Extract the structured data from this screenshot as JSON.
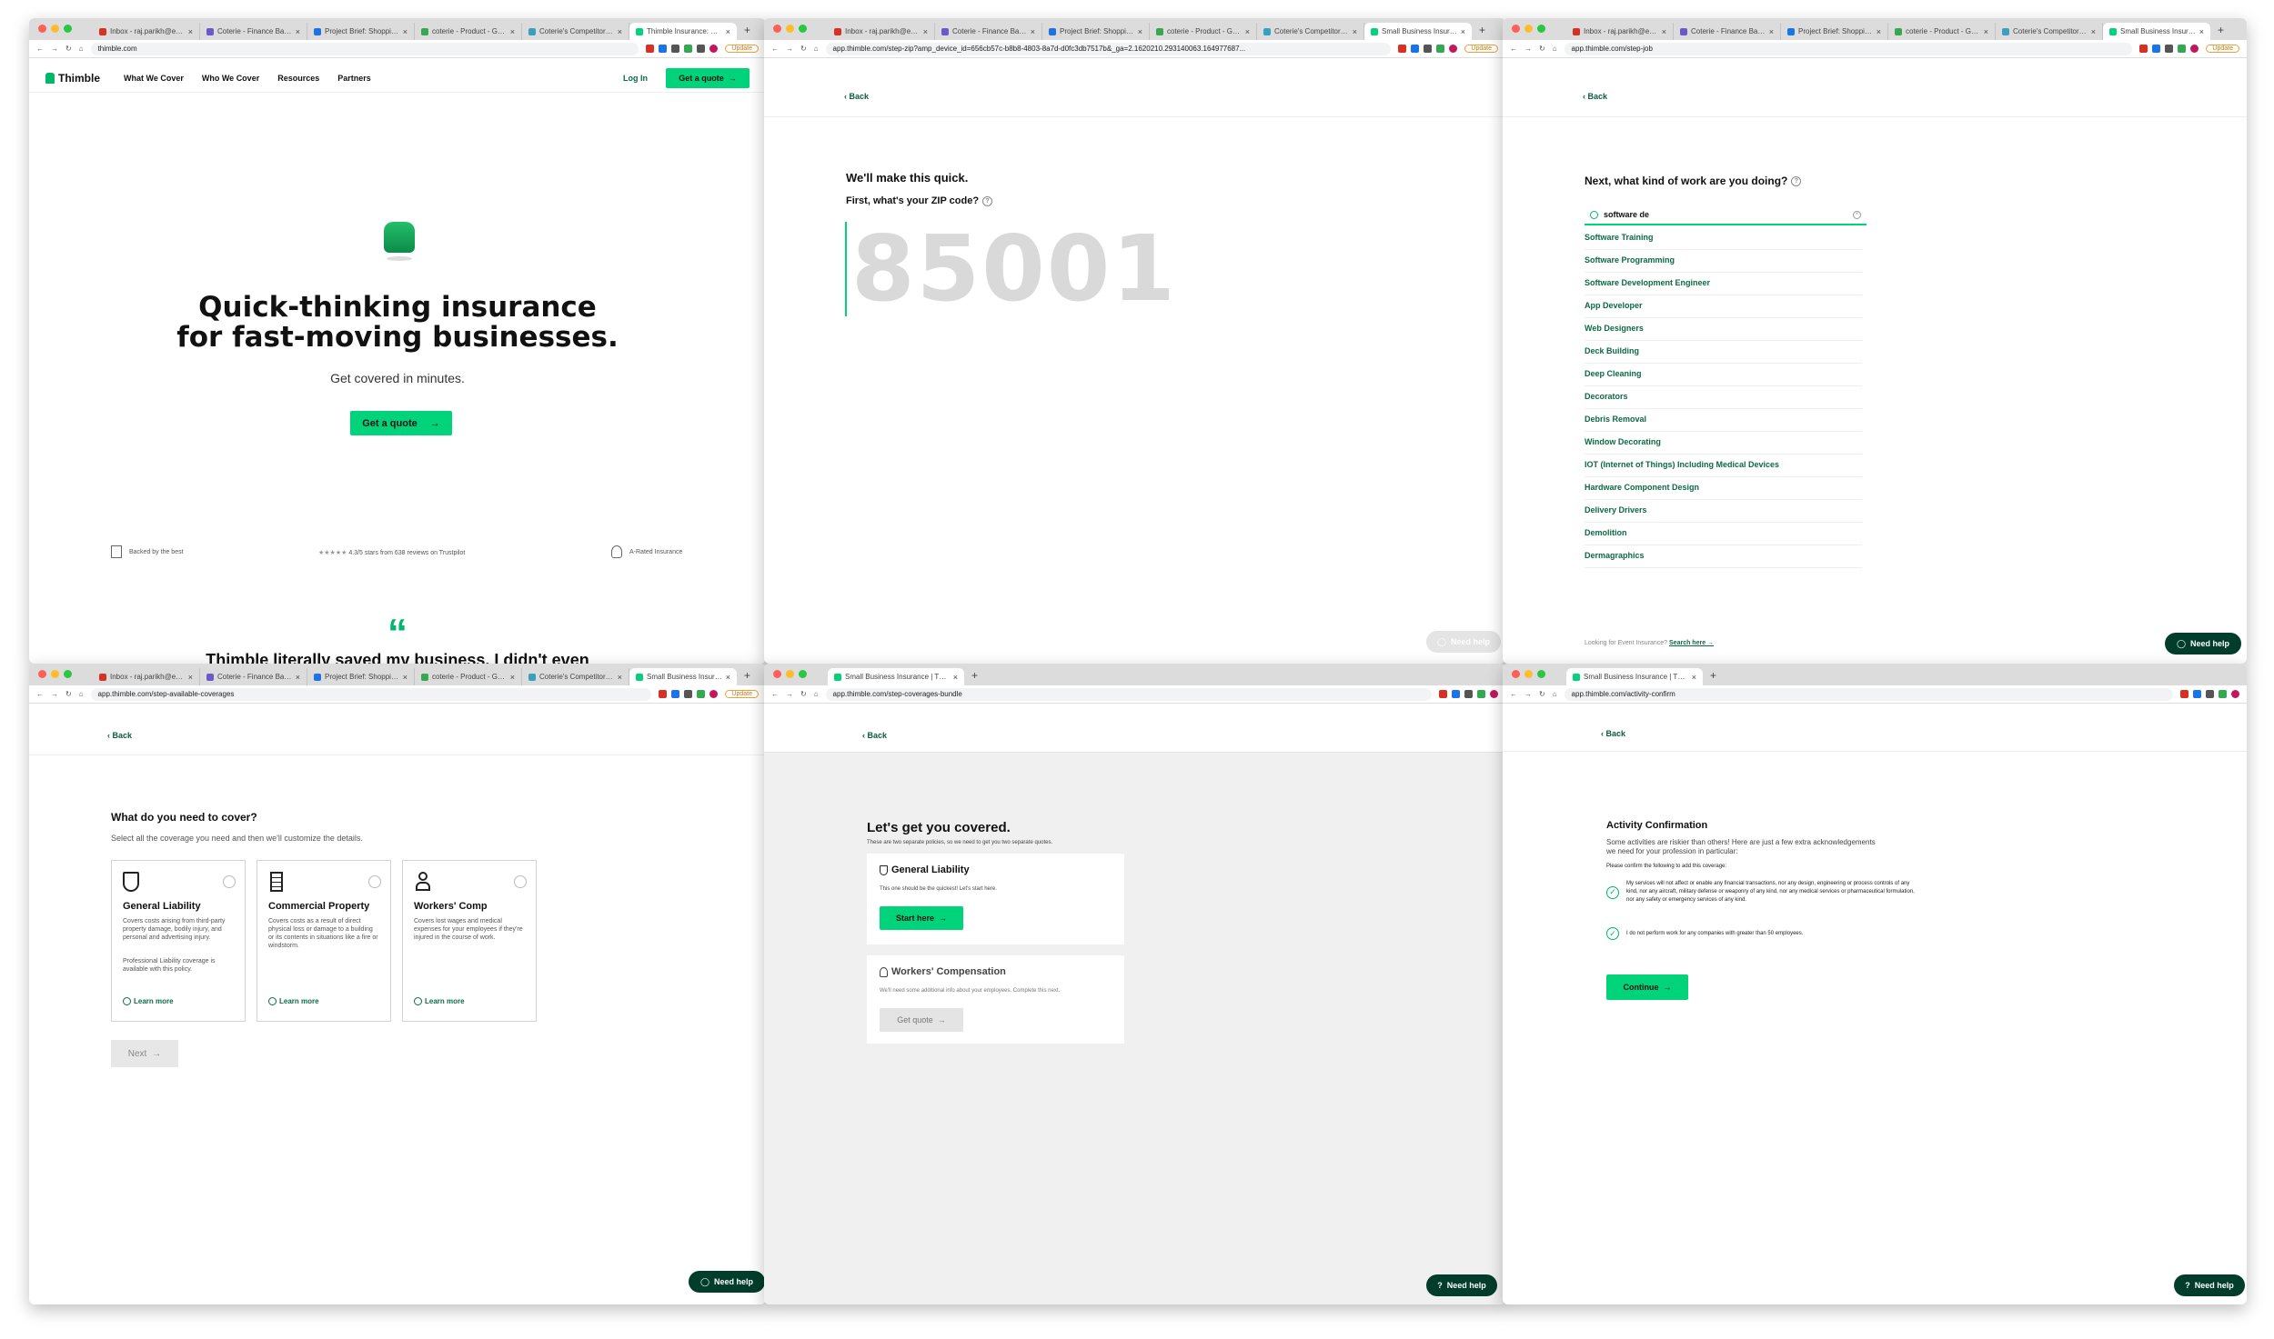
{
  "browser": {
    "tabs_main": [
      "Inbox - raj.parikh@embr...",
      "Coterie - Finance Basics",
      "Project Brief: Shopping e...",
      "coterie - Product - Goog...",
      "Coterie's Competitors, R...",
      "Small Business Insurance..."
    ],
    "tabs_short": [
      "Small Business Insurance | Thi..."
    ],
    "update_label": "Update"
  },
  "win1": {
    "tab_active": "Thimble Insurance: Onli...",
    "url": "thimble.com",
    "logo": "Thimble",
    "nav": [
      "What We Cover",
      "Who We Cover",
      "Resources",
      "Partners"
    ],
    "login": "Log In",
    "quote_button": "Get a quote",
    "headline1": "Quick-thinking insurance",
    "headline2": "for fast-moving businesses.",
    "subhead": "Get covered in minutes.",
    "cta": "Get a quote",
    "trust1": "Backed by the best",
    "trust2": "4.3/5 stars from 638 reviews on Trustpilot",
    "trust3": "A-Rated Insurance",
    "quote_mark": "“",
    "testimonial": "Thimble literally saved my business. I didn't even"
  },
  "win2": {
    "url": "app.thimble.com/step-zip?amp_device_id=656cb57c-b8b8-4803-8a7d-d0fc3db7517b&_ga=2.1620210.293140063.164977687...",
    "back": "Back",
    "title": "We'll make this quick.",
    "question": "First, what's your ZIP code?",
    "zip": "85001",
    "help": "Need help"
  },
  "win3": {
    "url": "app.thimble.com/step-job",
    "back": "Back",
    "question": "Next, what kind of work are you doing?",
    "search_value": "software de",
    "occupations": [
      "Software Training",
      "Software Programming",
      "Software Development Engineer",
      "App Developer",
      "Web Designers",
      "Deck Building",
      "Deep Cleaning",
      "Decorators",
      "Debris Removal",
      "Window Decorating",
      "IOT (Internet of Things) Including Medical Devices",
      "Hardware Component Design",
      "Delivery Drivers",
      "Demolition",
      "Dermagraphics"
    ],
    "footer_text": "Looking for Event Insurance?",
    "footer_link": "Search here →",
    "help": "Need help"
  },
  "win4": {
    "url": "app.thimble.com/step-available-coverages",
    "back": "Back",
    "title": "What do you need to cover?",
    "subtitle": "Select all the coverage you need and then we'll customize the details.",
    "cards": [
      {
        "title": "General Liability",
        "desc": "Covers costs arising from third-party property damage, bodily injury, and personal and advertising injury.",
        "note": "Professional Liability coverage is available with this policy.",
        "learn": "Learn more"
      },
      {
        "title": "Commercial Property",
        "desc": "Covers costs as a result of direct physical loss or damage to a building or its contents in situations like a fire or windstorm.",
        "note": "",
        "learn": "Learn more"
      },
      {
        "title": "Workers' Comp",
        "desc": "Covers lost wages and medical expenses for your employees if they're injured in the course of work.",
        "note": "",
        "learn": "Learn more"
      }
    ],
    "next": "Next",
    "help": "Need help"
  },
  "win5": {
    "url": "app.thimble.com/step-coverages-bundle",
    "back": "Back",
    "title": "Let's get you covered.",
    "subtitle": "These are two separate policies, so we need to get you two separate quotes.",
    "gl_title": "General Liability",
    "gl_desc": "This one should be the quickest! Let's start here.",
    "gl_button": "Start here",
    "wc_title": "Workers' Compensation",
    "wc_desc": "We'll need some additional info about your employees. Complete this next.",
    "wc_button": "Get quote",
    "help": "Need help"
  },
  "win6": {
    "url": "app.thimble.com/activity-confirm",
    "back": "Back",
    "title": "Activity Confirmation",
    "intro": "Some activities are riskier than others! Here are just a few extra acknowledgements we need for your profession in particular:",
    "prompt": "Please confirm the following to add this coverage:",
    "items": [
      "My services will not affect or enable any financial transactions, nor any design, engineering or process controls of any kind, nor any aircraft, military defense or weaponry of any kind, nor any medical services or pharmaceutical formulation, nor any safety or emergency services of any kind.",
      "I do not perform work for any companies with greater than 50 employees."
    ],
    "continue": "Continue",
    "help": "Need help"
  },
  "colors": {
    "brand_green": "#00d37a",
    "dark_green": "#003d2a",
    "link_green": "#0b6a46"
  }
}
